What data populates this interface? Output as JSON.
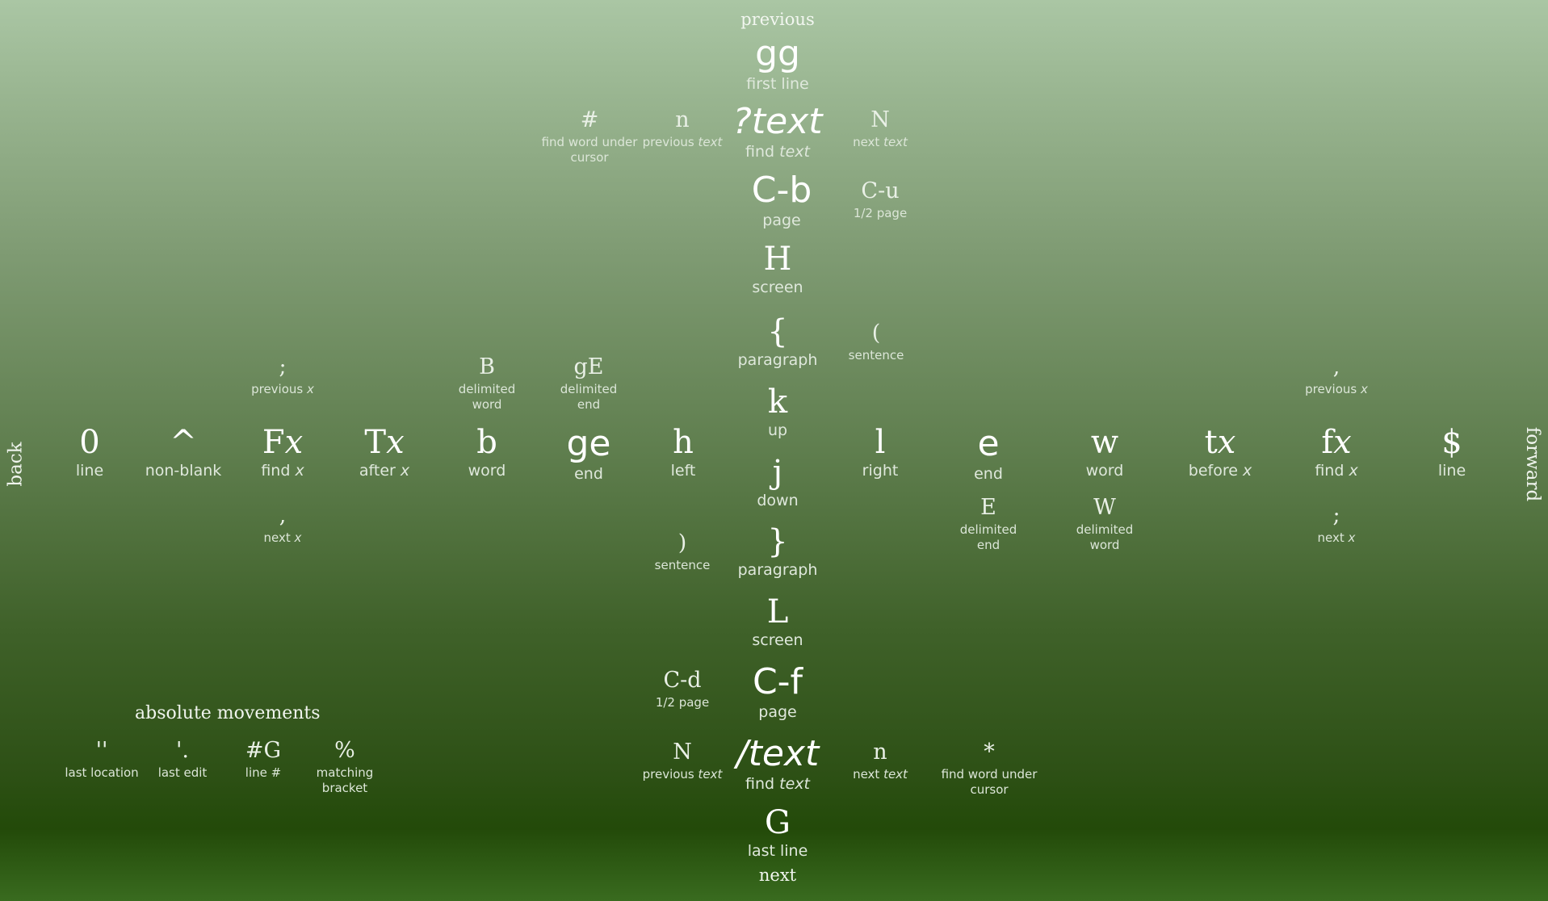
{
  "labels": {
    "previous": "previous",
    "next": "next",
    "back": "back",
    "forward": "forward",
    "absolute_title": "absolute movements"
  },
  "vertical": {
    "gg": {
      "key": "gg",
      "desc": "first line"
    },
    "qtext": {
      "key": "?text",
      "desc_a": "find ",
      "desc_b": "text"
    },
    "cb": {
      "key": "C-b",
      "desc": "page"
    },
    "H": {
      "key": "H",
      "desc": "screen"
    },
    "lbrace": {
      "key": "{",
      "desc": "paragraph"
    },
    "k": {
      "key": "k",
      "desc": "up"
    },
    "j": {
      "key": "j",
      "desc": "down"
    },
    "rbrace": {
      "key": "}",
      "desc": "paragraph"
    },
    "L": {
      "key": "L",
      "desc": "screen"
    },
    "cf": {
      "key": "C-f",
      "desc": "page"
    },
    "stext": {
      "key": "/text",
      "desc_a": "find ",
      "desc_b": "text"
    },
    "G": {
      "key": "G",
      "desc": "last line"
    }
  },
  "upper": {
    "hash": {
      "key": "#",
      "desc": "find word under cursor"
    },
    "n_prev": {
      "key": "n",
      "desc_a": "previous ",
      "desc_b": "text"
    },
    "N_next": {
      "key": "N",
      "desc_a": "next ",
      "desc_b": "text"
    },
    "cu": {
      "key": "C-u",
      "desc": "1/2 page"
    },
    "lparen": {
      "key": "(",
      "desc": "sentence"
    }
  },
  "lower": {
    "rparen": {
      "key": ")",
      "desc": "sentence"
    },
    "cd": {
      "key": "C-d",
      "desc": "1/2 page"
    },
    "N_prev": {
      "key": "N",
      "desc_a": "previous ",
      "desc_b": "text"
    },
    "n_next": {
      "key": "n",
      "desc_a": "next ",
      "desc_b": "text"
    },
    "star": {
      "key": "*",
      "desc": "find word under cursor"
    }
  },
  "horizontal": {
    "zero": {
      "key": "0",
      "desc": "line"
    },
    "caret": {
      "key": "^",
      "desc": "non-blank"
    },
    "Fx": {
      "key_a": "F",
      "key_b": "x",
      "desc_a": "find ",
      "desc_b": "x"
    },
    "Tx": {
      "key_a": "T",
      "key_b": "x",
      "desc_a": "after ",
      "desc_b": "x"
    },
    "b": {
      "key": "b",
      "desc": "word"
    },
    "ge": {
      "key": "ge",
      "desc": "end"
    },
    "h": {
      "key": "h",
      "desc": "left"
    },
    "l": {
      "key": "l",
      "desc": "right"
    },
    "e": {
      "key": "e",
      "desc": "end"
    },
    "w": {
      "key": "w",
      "desc": "word"
    },
    "tx": {
      "key_a": "t",
      "key_b": "x",
      "desc_a": "before ",
      "desc_b": "x"
    },
    "fx": {
      "key_a": "f",
      "key_b": "x",
      "desc_a": "find ",
      "desc_b": "x"
    },
    "dollar": {
      "key": "$",
      "desc": "line"
    }
  },
  "aux": {
    "semi_left": {
      "key": ";",
      "desc_a": "previous ",
      "desc_b": "x"
    },
    "comma_left": {
      "key": ",",
      "desc_a": "next ",
      "desc_b": "x"
    },
    "B": {
      "key": "B",
      "desc": "delimited word"
    },
    "gE": {
      "key": "gE",
      "desc": "delimited end"
    },
    "E": {
      "key": "E",
      "desc": "delimited end"
    },
    "W": {
      "key": "W",
      "desc": "delimited word"
    },
    "comma_right": {
      "key": ",",
      "desc_a": "previous ",
      "desc_b": "x"
    },
    "semi_right": {
      "key": ";",
      "desc_a": "next ",
      "desc_b": "x"
    }
  },
  "absolute": {
    "last_loc": {
      "key": "''",
      "desc": "last location"
    },
    "last_edit": {
      "key": "'.",
      "desc": "last edit"
    },
    "line_num": {
      "key": "#G",
      "desc_a": "line ",
      "desc_b": "#"
    },
    "bracket": {
      "key": "%",
      "desc": "matching bracket"
    }
  }
}
